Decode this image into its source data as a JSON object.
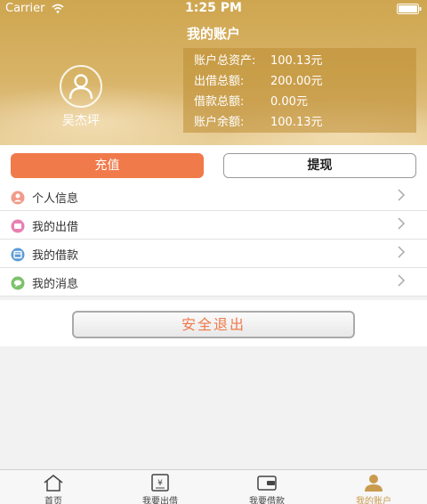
{
  "status_bar": {
    "carrier": "Carrier",
    "time": "1:25 PM"
  },
  "header": {
    "title": "我的账户",
    "username": "吴杰坪",
    "summary": [
      {
        "label": "账户总资产:",
        "value": "100.13元"
      },
      {
        "label": "出借总额:",
        "value": "200.00元"
      },
      {
        "label": "借款总额:",
        "value": "0.00元"
      },
      {
        "label": "账户余额:",
        "value": "100.13元"
      }
    ]
  },
  "actions": {
    "recharge": "充值",
    "withdraw": "提现"
  },
  "menu": [
    {
      "label": "个人信息",
      "icon": "person-info-icon",
      "color": "#f29b8a"
    },
    {
      "label": "我的出借",
      "icon": "lend-icon",
      "color": "#e97fb3"
    },
    {
      "label": "我的借款",
      "icon": "borrow-icon",
      "color": "#5b9ad8"
    },
    {
      "label": "我的消息",
      "icon": "message-icon",
      "color": "#7cc26c"
    }
  ],
  "logout": "安全退出",
  "tabbar": {
    "items": [
      {
        "label": "首页",
        "icon": "home-icon"
      },
      {
        "label": "我要出借",
        "icon": "lend-yen-icon"
      },
      {
        "label": "我要借款",
        "icon": "wallet-icon"
      },
      {
        "label": "我的账户",
        "icon": "account-icon"
      }
    ],
    "active_index": 3
  },
  "colors": {
    "header_gold": "#d8b468",
    "accent_orange": "#f07a4a",
    "active_tab": "#c99b4e"
  }
}
